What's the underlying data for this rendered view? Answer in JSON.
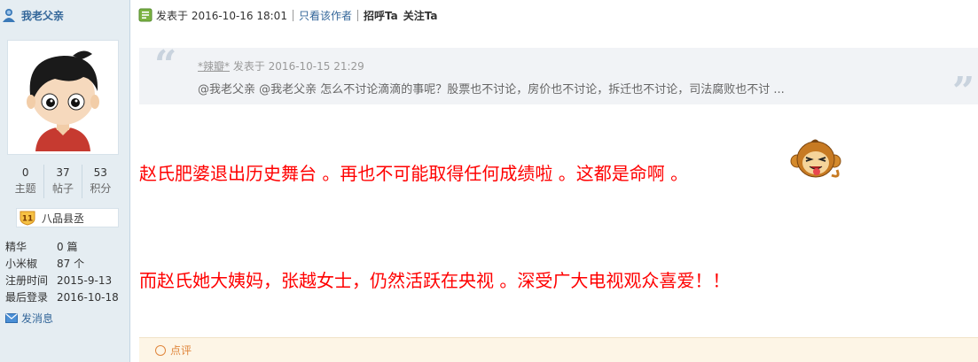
{
  "user": {
    "name": "我老父亲",
    "stats": [
      {
        "value": "0",
        "label": "主题"
      },
      {
        "value": "37",
        "label": "帖子"
      },
      {
        "value": "53",
        "label": "积分"
      }
    ],
    "grade_level": "11",
    "grade_title": "八品县丞",
    "info": [
      {
        "key": "精华",
        "value": "0 篇"
      },
      {
        "key": "小米椒",
        "value": "87 个"
      },
      {
        "key": "注册时间",
        "value": "2015-9-13"
      },
      {
        "key": "最后登录",
        "value": "2016-10-18"
      }
    ],
    "pm_label": "发消息"
  },
  "post": {
    "posted_at": "发表于 2016-10-16 18:01",
    "only_author": "只看该作者",
    "greet": "招呼Ta",
    "follow": "关注Ta",
    "quote": {
      "author": "*辣瓣*",
      "time": "发表于 2016-10-15 21:29",
      "body": "@我老父亲 @我老父亲  怎么不讨论滴滴的事呢？股票也不讨论，房价也不讨论，拆迁也不讨论，司法腐败也不讨 ...",
      "open_mark": "“",
      "close_mark": "”"
    },
    "line1": "赵氏肥婆退出历史舞台 。再也不可能取得任何成绩啦 。这都是命啊 。",
    "line2": "而赵氏她大姨妈，张越女士，仍然活跃在央视 。深受广大电视观众喜爱！！",
    "text_color": "#ff0000",
    "rate_label": "点评"
  }
}
